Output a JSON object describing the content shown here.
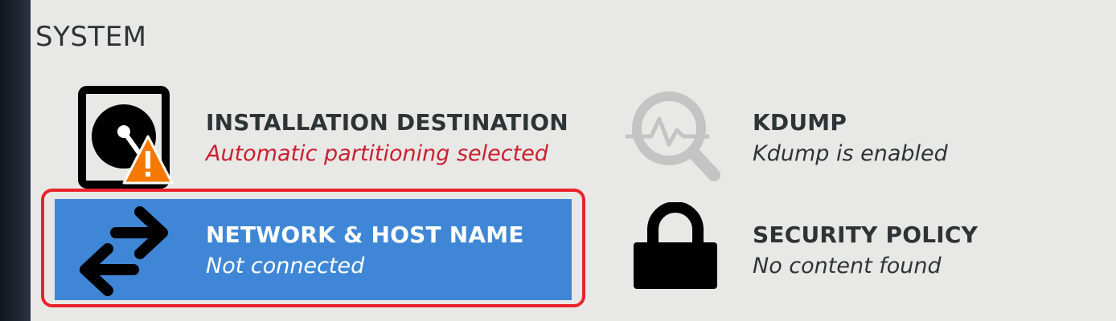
{
  "section": {
    "title": "SYSTEM"
  },
  "spokes": [
    {
      "id": "installation-destination",
      "icon": "hard-disk-warning-icon",
      "title": "INSTALLATION DESTINATION",
      "status": "Automatic partitioning selected",
      "status_color": "#c9202f"
    },
    {
      "id": "kdump",
      "icon": "kdump-magnifier-icon",
      "title": "KDUMP",
      "status": "Kdump is enabled"
    },
    {
      "id": "network-host-name",
      "icon": "network-arrows-icon",
      "title": "NETWORK & HOST NAME",
      "status": "Not connected",
      "selected": true,
      "highlight_color": "#3f87d6",
      "ring_color": "#e8232b"
    },
    {
      "id": "security-policy",
      "icon": "lock-icon",
      "title": "SECURITY POLICY",
      "status": "No content found"
    }
  ]
}
